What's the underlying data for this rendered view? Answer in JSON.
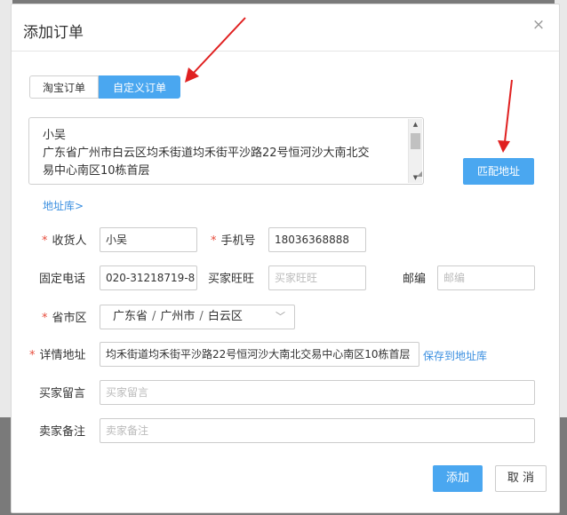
{
  "dialog": {
    "title": "添加订单",
    "close_glyph": "×"
  },
  "tabs": {
    "taobao_label": "淘宝订单",
    "custom_label": "自定义订单",
    "active": "custom"
  },
  "paste_box": {
    "line1": "小吴",
    "line2": "广东省广州市白云区均禾街道均禾街平沙路22号恒河沙大南北交",
    "line3": "易中心南区10栋首层"
  },
  "match_button_label": "匹配地址",
  "address_book_link": "地址库>",
  "form": {
    "required_mark": "*",
    "receiver_label": "收货人",
    "receiver_value": "小吴",
    "mobile_label": "手机号",
    "mobile_value": "18036368888",
    "phone_label": "固定电话",
    "phone_value": "020-31218719-8",
    "wangwang_label": "买家旺旺",
    "wangwang_placeholder": "买家旺旺",
    "postcode_label": "邮编",
    "postcode_placeholder": "邮编",
    "region_label": "省市区",
    "province": "广东省",
    "city": "广州市",
    "district": "白云区",
    "region_sep": "/",
    "detail_label": "详情地址",
    "detail_value": "均禾街道均禾街平沙路22号恒河沙大南北交易中心南区10栋首层",
    "save_address_link": "保存到地址库",
    "buyer_msg_label": "买家留言",
    "buyer_msg_placeholder": "买家留言",
    "seller_note_label": "卖家备注",
    "seller_note_placeholder": "卖家备注"
  },
  "footer": {
    "add_label": "添加",
    "cancel_label": "取 消"
  },
  "colors": {
    "accent": "#4aa7f0",
    "link": "#3b8fe0",
    "required": "#e74c3c",
    "annotation_arrow": "#e02020"
  }
}
